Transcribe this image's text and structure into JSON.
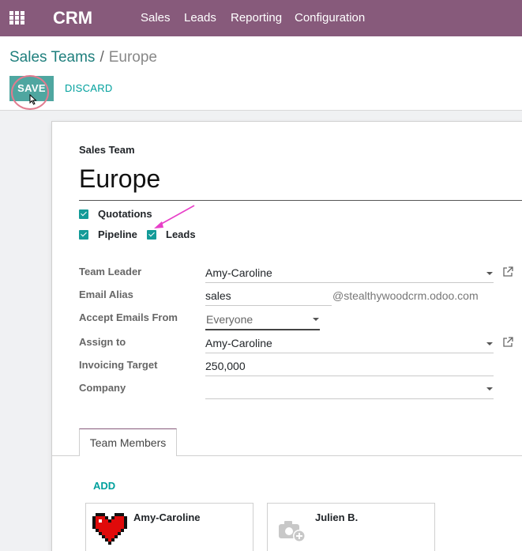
{
  "navbar": {
    "brand": "CRM",
    "menu": [
      "Sales",
      "Leads",
      "Reporting",
      "Configuration"
    ],
    "color": "#875a7b"
  },
  "breadcrumb": {
    "parent": "Sales Teams",
    "separator": "/",
    "current": "Europe"
  },
  "actions": {
    "save": "SAVE",
    "discard": "DISCARD"
  },
  "form": {
    "caption": "Sales Team",
    "name": "Europe",
    "checkboxes": {
      "quotations": "Quotations",
      "pipeline": "Pipeline",
      "leads": "Leads"
    },
    "fields": {
      "team_leader": {
        "label": "Team Leader",
        "value": "Amy-Caroline"
      },
      "email_alias": {
        "label": "Email Alias",
        "value": "sales",
        "domain": "@stealthywoodcrm.odoo.com"
      },
      "accept_emails": {
        "label": "Accept Emails From",
        "value": "Everyone"
      },
      "assign_to": {
        "label": "Assign to",
        "value": "Amy-Caroline"
      },
      "invoicing_target": {
        "label": "Invoicing Target",
        "value": "250,000"
      },
      "company": {
        "label": "Company",
        "value": ""
      }
    },
    "tab": "Team Members",
    "add": "ADD",
    "members": [
      {
        "name": "Amy-Caroline",
        "avatar": "heart-avatar"
      },
      {
        "name": "Julien B.",
        "avatar": "placeholder-camera-avatar"
      }
    ]
  },
  "colors": {
    "accent": "#00a09d",
    "checkbox": "#139b98",
    "annotation": "#e83fc8"
  }
}
